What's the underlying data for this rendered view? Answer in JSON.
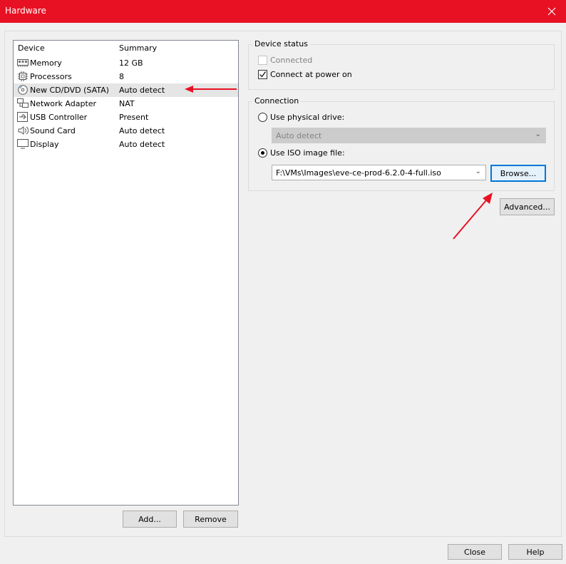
{
  "window": {
    "title": "Hardware"
  },
  "device_list": {
    "columns": [
      "Device",
      "Summary"
    ],
    "rows": [
      {
        "icon": "memory-icon",
        "name": "Memory",
        "summary": "12 GB"
      },
      {
        "icon": "processor-icon",
        "name": "Processors",
        "summary": "8"
      },
      {
        "icon": "cd-dvd-icon",
        "name": "New CD/DVD (SATA)",
        "summary": "Auto detect",
        "selected": true
      },
      {
        "icon": "network-adapter-icon",
        "name": "Network Adapter",
        "summary": "NAT"
      },
      {
        "icon": "usb-icon",
        "name": "USB Controller",
        "summary": "Present"
      },
      {
        "icon": "sound-card-icon",
        "name": "Sound Card",
        "summary": "Auto detect"
      },
      {
        "icon": "display-icon",
        "name": "Display",
        "summary": "Auto detect"
      }
    ],
    "add_label": "Add...",
    "remove_label": "Remove"
  },
  "device_status": {
    "title": "Device status",
    "connected_label": "Connected",
    "connected_checked": false,
    "connected_disabled": true,
    "power_on_label": "Connect at power on",
    "power_on_checked": true
  },
  "connection": {
    "title": "Connection",
    "physical_label": "Use physical drive:",
    "physical_value": "Auto detect",
    "iso_label": "Use ISO image file:",
    "iso_value": "F:\\VMs\\Images\\eve-ce-prod-6.2.0-4-full.iso",
    "selected": "iso",
    "browse_label": "Browse..."
  },
  "advanced_label": "Advanced...",
  "footer": {
    "close_label": "Close",
    "help_label": "Help"
  },
  "colors": {
    "titlebar": "#e81123",
    "annotation_arrow": "#e81123",
    "focus": "#0078d7"
  }
}
